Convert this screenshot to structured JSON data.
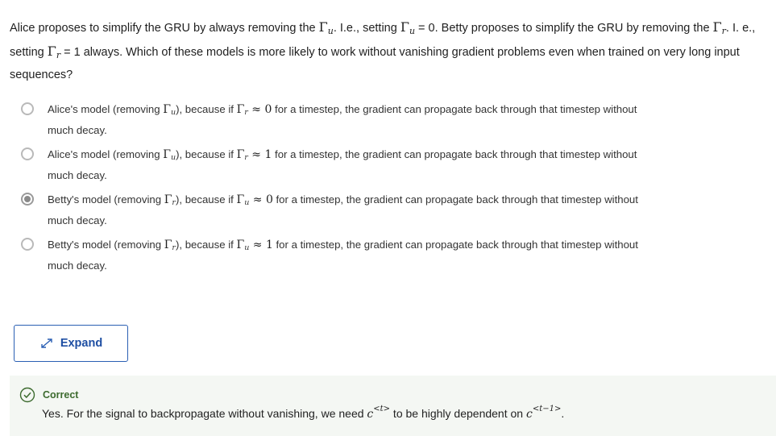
{
  "question": {
    "part1": "Alice proposes to simplify the GRU by always removing the ",
    "gamma": "Γ",
    "u": "u",
    "r": "r",
    "part2": ". I.e., setting ",
    "part3": " = 0. Betty proposes to simplify the GRU by removing the ",
    "part4": ". I. e., setting ",
    "part5": " = 1 always. Which of these models is more likely to work without vanishing gradient problems even when trained on very long input sequences?"
  },
  "options": [
    {
      "who": "Alice's model (removing ",
      "removed": "u",
      "mid": "), because if ",
      "gate": "r",
      "approx": " ≈ 0",
      "rest": " for a timestep, the gradient can propagate back through that timestep without much decay.",
      "selected": false
    },
    {
      "who": "Alice's model (removing ",
      "removed": "u",
      "mid": "), because if ",
      "gate": "r",
      "approx": " ≈ 1",
      "rest": " for a timestep, the gradient can propagate back through that timestep without much decay.",
      "selected": false
    },
    {
      "who": "Betty's model (removing ",
      "removed": "r",
      "mid": "), because if ",
      "gate": "u",
      "approx": " ≈ 0",
      "rest": " for a timestep, the gradient can propagate back through that timestep without much decay.",
      "selected": true
    },
    {
      "who": "Betty's model (removing ",
      "removed": "r",
      "mid": "), because if ",
      "gate": "u",
      "approx": " ≈ 1",
      "rest": " for a timestep, the gradient can propagate back through that timestep without much decay.",
      "selected": false
    }
  ],
  "expand_button": {
    "label": "Expand",
    "icon": "expand-arrows-icon"
  },
  "feedback": {
    "status": "Correct",
    "text1": "Yes. For the signal to backpropagate without vanishing, we need ",
    "c": "c",
    "sup1": "<t>",
    "text2": " to be highly dependent on ",
    "sup2": "<t−1>",
    "end": ".",
    "color": "#3d6b2f"
  }
}
